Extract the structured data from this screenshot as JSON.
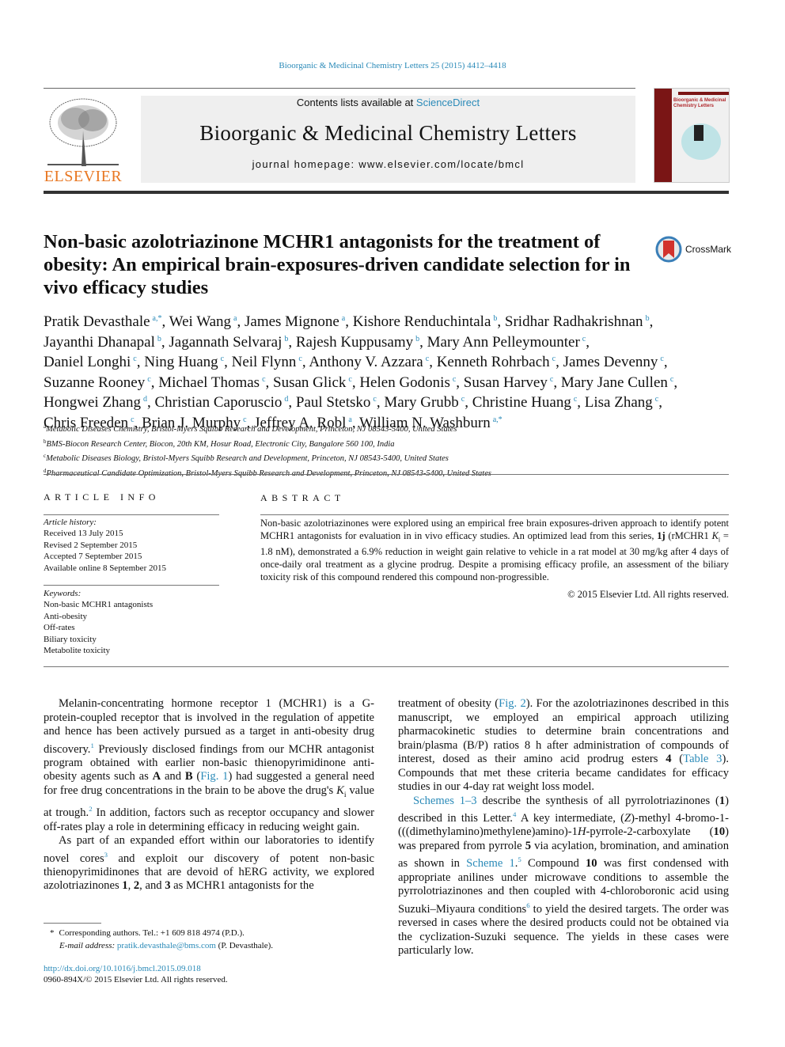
{
  "header": {
    "citation": "Bioorganic & Medicinal Chemistry Letters 25 (2015) 4412–4418",
    "contents_prefix": "Contents lists available at ",
    "contents_link": "ScienceDirect",
    "journal_title": "Bioorganic & Medicinal Chemistry Letters",
    "homepage": "journal homepage: www.elsevier.com/locate/bmcl",
    "publisher_logo": "ELSEVIER",
    "cover_title": "Bioorganic & Medicinal Chemistry Letters",
    "crossmark": "CrossMark",
    "colors": {
      "link": "#2a8ab8",
      "elsevier": "#e87722",
      "cover_band": "#7a1515"
    }
  },
  "article": {
    "title": "Non-basic azolotriazinone MCHR1 antagonists for the treatment of obesity: An empirical brain-exposures-driven candidate selection for in vivo efficacy studies",
    "authors": [
      {
        "name": "Pratik Devasthale",
        "aff": "a,*"
      },
      {
        "name": "Wei Wang",
        "aff": "a"
      },
      {
        "name": "James Mignone",
        "aff": "a"
      },
      {
        "name": "Kishore Renduchintala",
        "aff": "b"
      },
      {
        "name": "Sridhar Radhakrishnan",
        "aff": "b"
      },
      {
        "name": "Jayanthi Dhanapal",
        "aff": "b"
      },
      {
        "name": "Jagannath Selvaraj",
        "aff": "b"
      },
      {
        "name": "Rajesh Kuppusamy",
        "aff": "b"
      },
      {
        "name": "Mary Ann Pelleymounter",
        "aff": "c"
      },
      {
        "name": "Daniel Longhi",
        "aff": "c"
      },
      {
        "name": "Ning Huang",
        "aff": "c"
      },
      {
        "name": "Neil Flynn",
        "aff": "c"
      },
      {
        "name": "Anthony V. Azzara",
        "aff": "c"
      },
      {
        "name": "Kenneth Rohrbach",
        "aff": "c"
      },
      {
        "name": "James Devenny",
        "aff": "c"
      },
      {
        "name": "Suzanne Rooney",
        "aff": "c"
      },
      {
        "name": "Michael Thomas",
        "aff": "c"
      },
      {
        "name": "Susan Glick",
        "aff": "c"
      },
      {
        "name": "Helen Godonis",
        "aff": "c"
      },
      {
        "name": "Susan Harvey",
        "aff": "c"
      },
      {
        "name": "Mary Jane Cullen",
        "aff": "c"
      },
      {
        "name": "Hongwei Zhang",
        "aff": "d"
      },
      {
        "name": "Christian Caporuscio",
        "aff": "d"
      },
      {
        "name": "Paul Stetsko",
        "aff": "c"
      },
      {
        "name": "Mary Grubb",
        "aff": "c"
      },
      {
        "name": "Christine Huang",
        "aff": "c"
      },
      {
        "name": "Lisa Zhang",
        "aff": "c"
      },
      {
        "name": "Chris Freeden",
        "aff": "c"
      },
      {
        "name": "Brian J. Murphy",
        "aff": "c"
      },
      {
        "name": "Jeffrey A. Robl",
        "aff": "a"
      },
      {
        "name": "William N. Washburn",
        "aff": "a,*"
      }
    ],
    "affiliations": [
      {
        "key": "a",
        "text": "Metabolic Diseases Chemistry, Bristol-Myers Squibb Research and Development, Princeton, NJ 08543-5400, United States"
      },
      {
        "key": "b",
        "text": "BMS-Biocon Research Center, Biocon, 20th KM, Hosur Road, Electronic City, Bangalore 560 100, India"
      },
      {
        "key": "c",
        "text": "Metabolic Diseases Biology, Bristol-Myers Squibb Research and Development, Princeton, NJ 08543-5400, United States"
      },
      {
        "key": "d",
        "text": "Pharmaceutical Candidate Optimization, Bristol-Myers Squibb Research and Development, Princeton, NJ 08543-5400, United States"
      }
    ]
  },
  "article_info": {
    "heading": "ARTICLE INFO",
    "history_label": "Article history:",
    "history": [
      "Received 13 July 2015",
      "Revised 2 September 2015",
      "Accepted 7 September 2015",
      "Available online 8 September 2015"
    ],
    "keywords_label": "Keywords:",
    "keywords": [
      "Non-basic MCHR1 antagonists",
      "Anti-obesity",
      "Off-rates",
      "Biliary toxicity",
      "Metabolite toxicity"
    ]
  },
  "abstract": {
    "heading": "ABSTRACT",
    "segments": [
      {
        "t": "Non-basic azolotriazinones were explored using an empirical free brain exposures-driven approach to identify potent MCHR1 antagonists for evaluation in in vivo efficacy studies. An optimized lead from this series, "
      },
      {
        "t": "1j",
        "s": "b"
      },
      {
        "t": " (rMCHR1 "
      },
      {
        "t": "K",
        "s": "i"
      },
      {
        "t": "i",
        "s": "sub"
      },
      {
        "t": " = 1.8 nM), demonstrated a 6.9% reduction in weight gain relative to vehicle in a rat model at 30 mg/kg after 4 days of once-daily oral treatment as a glycine prodrug. Despite a promising efficacy profile, an assessment of the biliary toxicity risk of this compound rendered this compound non-progressible."
      }
    ],
    "copyright": "© 2015 Elsevier Ltd. All rights reserved."
  },
  "body": {
    "left": [
      [
        {
          "t": "Melanin-concentrating hormone receptor 1 (MCHR1) is a G-protein-coupled receptor that is involved in the regulation of appetite and hence has been actively pursued as a target in anti-obesity drug discovery."
        },
        {
          "t": "1",
          "s": "sup"
        },
        {
          "t": " Previously disclosed findings from our MCHR antagonist program obtained with earlier non-basic thienopyrimidinone anti-obesity agents such as "
        },
        {
          "t": "A",
          "s": "b"
        },
        {
          "t": " and "
        },
        {
          "t": "B",
          "s": "b"
        },
        {
          "t": " ("
        },
        {
          "t": "Fig. 1",
          "s": "link"
        },
        {
          "t": ") had suggested a general need for free drug concentrations in the brain to be above the drug's "
        },
        {
          "t": "K",
          "s": "i"
        },
        {
          "t": "i",
          "s": "sub"
        },
        {
          "t": " value at trough."
        },
        {
          "t": "2",
          "s": "sup"
        },
        {
          "t": " In addition, factors such as receptor occupancy and slower off-rates play a role in determining efficacy in reducing weight gain."
        }
      ],
      [
        {
          "t": "As part of an expanded effort within our laboratories to identify novel cores"
        },
        {
          "t": "3",
          "s": "sup"
        },
        {
          "t": " and exploit our discovery of potent non-basic thienopyrimidinones that are devoid of hERG activity, we explored azolotriazinones "
        },
        {
          "t": "1",
          "s": "b"
        },
        {
          "t": ", "
        },
        {
          "t": "2",
          "s": "b"
        },
        {
          "t": ", and "
        },
        {
          "t": "3",
          "s": "b"
        },
        {
          "t": " as MCHR1 antagonists for the"
        }
      ]
    ],
    "right": [
      [
        {
          "t": "treatment of obesity ("
        },
        {
          "t": "Fig. 2",
          "s": "link"
        },
        {
          "t": "). For the azolotriazinones described in this manuscript, we employed an empirical approach utilizing pharmacokinetic studies to determine brain concentrations and brain/plasma (B/P) ratios 8 h after administration of compounds of interest, dosed as their amino acid prodrug esters "
        },
        {
          "t": "4",
          "s": "b"
        },
        {
          "t": " ("
        },
        {
          "t": "Table 3",
          "s": "link"
        },
        {
          "t": "). Compounds that met these criteria became candidates for efficacy studies in our 4-day rat weight loss model."
        }
      ],
      [
        {
          "t": "Schemes 1–3",
          "s": "link"
        },
        {
          "t": " describe the synthesis of all pyrrolotriazinones ("
        },
        {
          "t": "1",
          "s": "b"
        },
        {
          "t": ") described in this Letter."
        },
        {
          "t": "4",
          "s": "sup"
        },
        {
          "t": " A key intermediate, ("
        },
        {
          "t": "Z",
          "s": "i"
        },
        {
          "t": ")-methyl 4-bromo-1-(((dimethylamino)methylene)amino)-1"
        },
        {
          "t": "H",
          "s": "i"
        },
        {
          "t": "-pyrrole-2-carboxylate ("
        },
        {
          "t": "10",
          "s": "b"
        },
        {
          "t": ") was prepared from pyrrole "
        },
        {
          "t": "5",
          "s": "b"
        },
        {
          "t": " via acylation, bromination, and amination as shown in "
        },
        {
          "t": "Scheme 1",
          "s": "link"
        },
        {
          "t": "."
        },
        {
          "t": "5",
          "s": "sup"
        },
        {
          "t": " Compound "
        },
        {
          "t": "10",
          "s": "b"
        },
        {
          "t": " was first condensed with appropriate anilines under microwave conditions to assemble the pyrrolotriazinones and then coupled with 4-chloroboronic acid using Suzuki–Miyaura conditions"
        },
        {
          "t": "6",
          "s": "sup"
        },
        {
          "t": " to yield the desired targets. The order was reversed in cases where the desired products could not be obtained via the cyclization-Suzuki sequence. The yields in these cases were particularly low."
        }
      ]
    ]
  },
  "footnote": {
    "corresponding": "Corresponding authors. Tel.: +1 609 818 4974 (P.D.).",
    "email_label": "E-mail address: ",
    "email": "pratik.devasthale@bms.com",
    "email_suffix": " (P. Devasthale).",
    "doi": "http://dx.doi.org/10.1016/j.bmcl.2015.09.018",
    "issn": "0960-894X/© 2015 Elsevier Ltd. All rights reserved."
  }
}
